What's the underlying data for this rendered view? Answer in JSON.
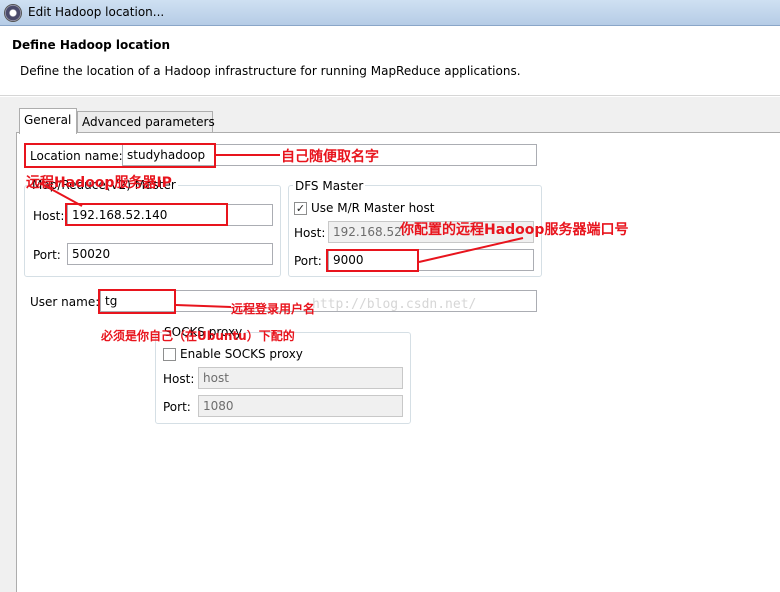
{
  "window": {
    "title": "Edit Hadoop location..."
  },
  "header": {
    "title": "Define Hadoop location",
    "description": "Define the location of a Hadoop infrastructure for running MapReduce applications."
  },
  "tabs": [
    {
      "label": "General",
      "active": true
    },
    {
      "label": "Advanced parameters",
      "active": false
    }
  ],
  "general": {
    "location_name_label": "Location name:",
    "location_name_value": "studyhadoop",
    "mapreduce_master": {
      "title": "Map/Reduce(V2) Master",
      "host_label": "Host:",
      "host_value": "192.168.52.140",
      "port_label": "Port:",
      "port_value": "50020"
    },
    "dfs_master": {
      "title": "DFS Master",
      "use_mr_host_label": "Use M/R Master host",
      "use_mr_host_checked": true,
      "host_label": "Host:",
      "host_value": "192.168.52.",
      "port_label": "Port:",
      "port_value": "9000"
    },
    "user_name_label": "User name:",
    "user_name_value": "tg",
    "socks_proxy": {
      "title": "SOCKS proxy",
      "enable_label": "Enable SOCKS proxy",
      "enable_checked": false,
      "host_label": "Host:",
      "host_value": "host",
      "port_label": "Port:",
      "port_value": "1080"
    }
  },
  "annotations": {
    "location_name_note": "自己随便取名字",
    "remote_ip_note": "远程Hadoop服务器IP",
    "dfs_port_note": "你配置的远程Hadoop服务器端口号",
    "user_name_note": "远程登录用户名",
    "ubuntu_note": "必须是你自己（在Ubuntu）下配的"
  },
  "watermark": "http://blog.csdn.net/",
  "colors": {
    "annotation_red": "#e8141d",
    "titlebar": "#c3d6ec"
  }
}
